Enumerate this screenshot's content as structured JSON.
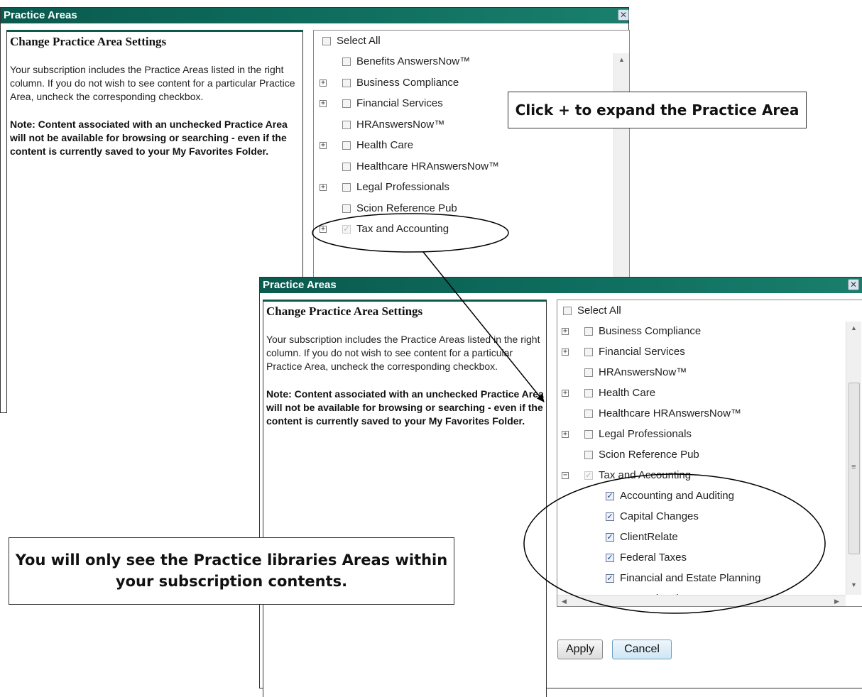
{
  "dialog1": {
    "title": "Practice Areas",
    "close_glyph": "✕",
    "heading": "Change Practice Area Settings",
    "description": "Your subscription includes the Practice Areas listed in the right column. If you do not wish to see content for a particular Practice Area, uncheck the corresponding checkbox.",
    "note": "Note: Content associated with an unchecked Practice Area will not be available for browsing or searching - even if the content is currently saved to your My Favorites Folder.",
    "select_all": "Select All",
    "items": [
      {
        "label": "Benefits AnswersNow™",
        "expandable": false,
        "checked": false
      },
      {
        "label": "Business Compliance",
        "expandable": true,
        "checked": false
      },
      {
        "label": "Financial Services",
        "expandable": true,
        "checked": false
      },
      {
        "label": "HRAnswersNow™",
        "expandable": false,
        "checked": false
      },
      {
        "label": "Health Care",
        "expandable": true,
        "checked": false
      },
      {
        "label": "Healthcare HRAnswersNow™",
        "expandable": false,
        "checked": false
      },
      {
        "label": "Legal Professionals",
        "expandable": true,
        "checked": false
      },
      {
        "label": "Scion Reference Pub",
        "expandable": false,
        "checked": false
      },
      {
        "label": "Tax and Accounting",
        "expandable": true,
        "checked": true,
        "disabled": true
      }
    ]
  },
  "dialog2": {
    "title": "Practice Areas",
    "close_glyph": "✕",
    "heading": "Change Practice Area Settings",
    "description": "Your subscription includes the Practice Areas listed in the right column. If you do not wish to see content for a particular Practice Area, uncheck the corresponding checkbox.",
    "note": "Note: Content associated with an unchecked Practice Area will not be available for browsing or searching - even if the content is currently saved to your My Favorites Folder.",
    "select_all": "Select All",
    "items": [
      {
        "label": "Business Compliance",
        "expandable": true,
        "checked": false
      },
      {
        "label": "Financial Services",
        "expandable": true,
        "checked": false
      },
      {
        "label": "HRAnswersNow™",
        "expandable": false,
        "checked": false
      },
      {
        "label": "Health Care",
        "expandable": true,
        "checked": false
      },
      {
        "label": "Healthcare HRAnswersNow™",
        "expandable": false,
        "checked": false
      },
      {
        "label": "Legal Professionals",
        "expandable": true,
        "checked": false
      },
      {
        "label": "Scion Reference Pub",
        "expandable": false,
        "checked": false
      },
      {
        "label": "Tax and Accounting",
        "expandable": true,
        "expanded": true,
        "checked": true,
        "disabled": true
      }
    ],
    "subitems": [
      {
        "label": "Accounting and Auditing",
        "checked": true
      },
      {
        "label": "Capital Changes",
        "checked": true
      },
      {
        "label": "ClientRelate",
        "checked": true
      },
      {
        "label": "Federal Taxes",
        "checked": true
      },
      {
        "label": "Financial and Estate Planning",
        "checked": true
      },
      {
        "label": "International",
        "checked": true
      }
    ],
    "apply_label": "Apply",
    "cancel_label": "Cancel"
  },
  "callouts": {
    "expand_hint": "Click + to expand the Practice Area",
    "subscription_hint": "You will only see the Practice libraries Areas within your subscription contents."
  },
  "glyphs": {
    "plus": "+",
    "minus": "−",
    "check": "✓",
    "scroll_up": "▲",
    "scroll_down": "▼",
    "scroll_left": "◀",
    "scroll_right": "▶",
    "grip": "≡"
  }
}
